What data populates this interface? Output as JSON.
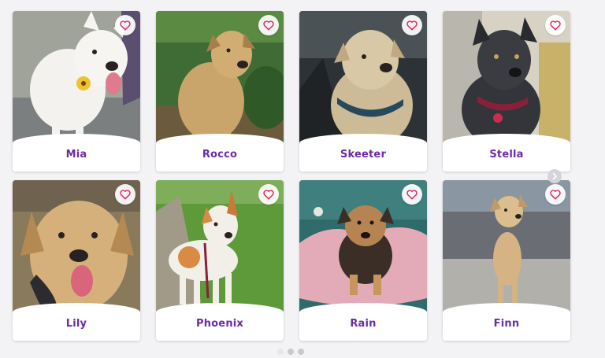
{
  "pets": [
    {
      "name": "Mia",
      "favorite_icon": "heart-outline-icon"
    },
    {
      "name": "Rocco",
      "favorite_icon": "heart-outline-icon"
    },
    {
      "name": "Skeeter",
      "favorite_icon": "heart-outline-icon"
    },
    {
      "name": "Stella",
      "favorite_icon": "heart-outline-icon"
    },
    {
      "name": "Lily",
      "favorite_icon": "heart-outline-icon"
    },
    {
      "name": "Phoenix",
      "favorite_icon": "heart-outline-icon"
    },
    {
      "name": "Rain",
      "favorite_icon": "heart-outline-icon"
    },
    {
      "name": "Finn",
      "favorite_icon": "heart-outline-icon"
    }
  ],
  "carousel": {
    "next_icon": "chevron-right-icon",
    "page_count": 3,
    "active_page": 1
  },
  "colors": {
    "name_text": "#6b2aa8",
    "heart": "#e0245e",
    "background": "#f3f2f5"
  }
}
